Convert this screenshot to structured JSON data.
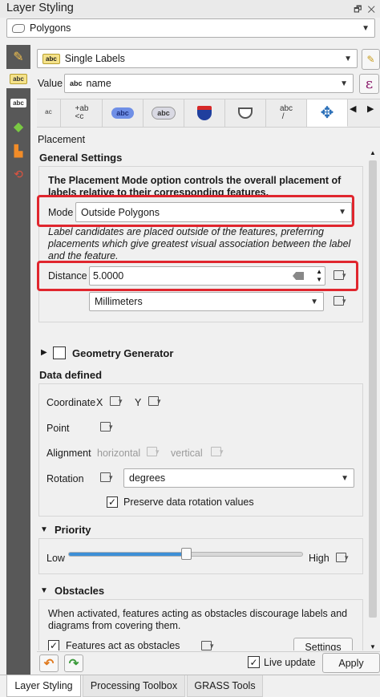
{
  "window": {
    "title": "Layer Styling",
    "title_icons": "🗗 ✕"
  },
  "layer_combo": {
    "value": "Polygons"
  },
  "renderer_combo": {
    "badge": "abc",
    "value": "Single Labels"
  },
  "value_row": {
    "label": "Value",
    "badge": "abc",
    "value": "name",
    "expr_symbol": "ε"
  },
  "tabs": [
    {
      "name": "tab-text",
      "glyph": "ᵃᶜ"
    },
    {
      "name": "tab-formatting",
      "glyph": "+ab<c"
    },
    {
      "name": "tab-buffer",
      "glyph": "abc"
    },
    {
      "name": "tab-background",
      "glyph": "abc"
    },
    {
      "name": "tab-shadow",
      "glyph": "◈"
    },
    {
      "name": "tab-callouts",
      "glyph": "◗"
    },
    {
      "name": "tab-placement-line",
      "glyph": "abc/"
    },
    {
      "name": "tab-placement",
      "glyph": "✥"
    }
  ],
  "panel_title": "Placement",
  "general": {
    "heading": "General Settings",
    "description": "The Placement Mode option controls the overall placement of labels relative to their corresponding features.",
    "mode_label": "Mode",
    "mode_value": "Outside Polygons",
    "mode_help": "Label candidates are placed outside of the features, preferring placements which give greatest visual association between the label and the feature.",
    "distance_label": "Distance",
    "distance_value": "5.0000",
    "units_value": "Millimeters"
  },
  "geometry_generator": {
    "label": "Geometry Generator"
  },
  "data_defined": {
    "heading": "Data defined",
    "coordinate_label": "Coordinate",
    "x_label": "X",
    "y_label": "Y",
    "point_label": "Point",
    "alignment_label": "Alignment",
    "horizontal_label": "horizontal",
    "vertical_label": "vertical",
    "rotation_label": "Rotation",
    "rotation_units": "degrees",
    "preserve_label": "Preserve data rotation values"
  },
  "priority": {
    "heading": "Priority",
    "low_label": "Low",
    "high_label": "High",
    "level": 0.5
  },
  "obstacles": {
    "heading": "Obstacles",
    "description": "When activated, features acting as obstacles discourage labels and diagrams from covering them.",
    "checkbox_label": "Features act as obstacles",
    "settings_label": "Settings"
  },
  "footer": {
    "live_update_label": "Live update",
    "apply_label": "Apply"
  },
  "bottom_tabs": [
    "Layer Styling",
    "Processing Toolbox",
    "GRASS Tools"
  ],
  "colors": {
    "highlight": "#e0262e",
    "slider": "#3d8fd6",
    "sidebar": "#585858"
  }
}
